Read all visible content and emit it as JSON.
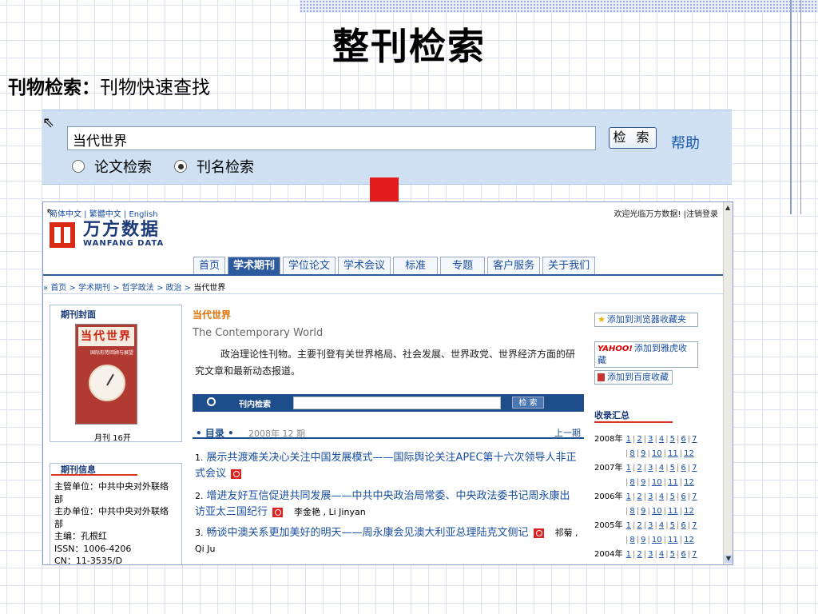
{
  "slide": {
    "title": "整刊检索",
    "subtitle_bold": "刊物检索：",
    "subtitle_rest": "刊物快速查找"
  },
  "search_panel": {
    "query": "当代世界",
    "button": "检 索",
    "help": "帮助",
    "radio_article": "论文检索",
    "radio_journal": "刊名检索",
    "selected": "刊名检索"
  },
  "web": {
    "lang_links": "简体中文 | 繁體中文 | English",
    "welcome": "欢迎光临万方数据!  |注销登录",
    "logo_cn": "万方数据",
    "logo_en": "WANFANG DATA",
    "nav": [
      "首页",
      "学术期刊",
      "学位论文",
      "学术会议",
      "标准",
      "专题",
      "客户服务",
      "关于我们"
    ],
    "breadcrumb_links": "» 首页 > 学术期刊 > 哲学政法 > 政治 > ",
    "breadcrumb_current": "当代世界",
    "cover_head": "期刊封面",
    "cover_title": "当代世界",
    "cover_sub": "国际形势回顾与展望",
    "frequency": "月刊  16开",
    "info_head": "期刊信息",
    "info_lines": [
      "主管单位：中共中央对外联络部",
      "主办单位：中共中央对外联络部",
      "主编：孔根红",
      "ISSN：1006-4206",
      "CN：11-3535/D"
    ],
    "journal_title": "当代世界",
    "journal_en": "The Contemporary World",
    "journal_desc": "政治理论性刊物。主要刊登有关世界格局、社会发展、世界政党、世界经济方面的研究文章和最新动态报道。",
    "inner_search_label": "刊内检索",
    "inner_search_btn": "检 索",
    "toc_label": "• 目录 •",
    "toc_issue": "2008年 12 期",
    "toc_prev": "上一期",
    "articles": [
      {
        "n": "1.",
        "title": "展示共渡难关决心关注中国发展模式——国际舆论关注APEC第十六次领导人非正式会议",
        "author": ""
      },
      {
        "n": "2.",
        "title": "增进友好互信促进共同发展——中共中央政治局常委、中央政法委书记周永康出访亚太三国纪行",
        "author": "李金艳 , Li Jinyan"
      },
      {
        "n": "3.",
        "title": "畅谈中澳关系更加美好的明天——周永康会见澳大利亚总理陆克文侧记",
        "author": "祁菊 , Qi Ju"
      }
    ],
    "fav": [
      {
        "label": "添加到浏览器收藏夹",
        "icon": "star-icon"
      },
      {
        "label": "添加到雅虎收藏",
        "icon": "yahoo-icon",
        "brand": "YAHOO!"
      },
      {
        "label": "添加到百度收藏",
        "icon": "baidu-icon"
      }
    ],
    "collection_head": "收录汇总",
    "years": [
      {
        "year": "2008年",
        "row1": [
          "1",
          "2",
          "3",
          "4",
          "5",
          "6",
          "7"
        ],
        "row2": [
          "8",
          "9",
          "10",
          "11",
          "12"
        ]
      },
      {
        "year": "2007年",
        "row1": [
          "1",
          "2",
          "3",
          "4",
          "5",
          "6",
          "7"
        ],
        "row2": [
          "8",
          "9",
          "10",
          "11",
          "12"
        ]
      },
      {
        "year": "2006年",
        "row1": [
          "1",
          "2",
          "3",
          "4",
          "5",
          "6",
          "7"
        ],
        "row2": [
          "8",
          "9",
          "10",
          "11",
          "12"
        ]
      },
      {
        "year": "2005年",
        "row1": [
          "1",
          "2",
          "3",
          "4",
          "5",
          "6",
          "7"
        ],
        "row2": [
          "8",
          "9",
          "10",
          "11",
          "12"
        ]
      },
      {
        "year": "2004年",
        "row1": [
          "1",
          "2",
          "3",
          "4",
          "5",
          "6",
          "7"
        ],
        "row2": []
      }
    ]
  },
  "colors": {
    "nav_active": "#2c5a9c",
    "link": "#1a4fa0",
    "accent_orange": "#e07000",
    "arrow_red": "#e31b1b"
  }
}
